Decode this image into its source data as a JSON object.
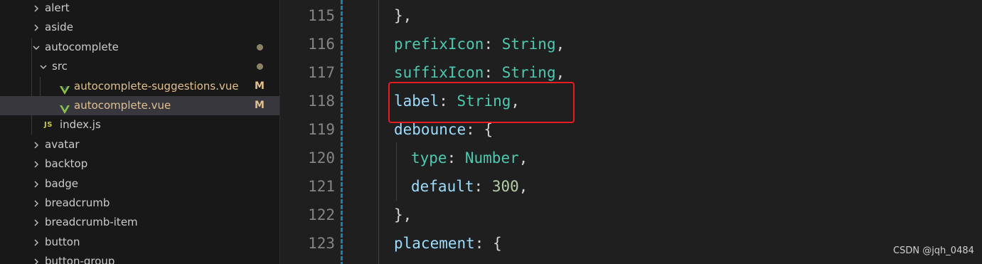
{
  "sidebar": {
    "items": [
      {
        "label": "alert",
        "kind": "folder",
        "expanded": false
      },
      {
        "label": "aside",
        "kind": "folder",
        "expanded": false
      },
      {
        "label": "autocomplete",
        "kind": "folder",
        "expanded": true,
        "modified_dot": true
      },
      {
        "label": "src",
        "kind": "folder",
        "expanded": true,
        "modified_dot": true
      },
      {
        "label": "autocomplete-suggestions.vue",
        "kind": "vue",
        "status": "M"
      },
      {
        "label": "autocomplete.vue",
        "kind": "vue",
        "status": "M",
        "selected": true
      },
      {
        "label": "index.js",
        "kind": "js",
        "icon_text": "JS"
      },
      {
        "label": "avatar",
        "kind": "folder",
        "expanded": false
      },
      {
        "label": "backtop",
        "kind": "folder",
        "expanded": false
      },
      {
        "label": "badge",
        "kind": "folder",
        "expanded": false
      },
      {
        "label": "breadcrumb",
        "kind": "folder",
        "expanded": false
      },
      {
        "label": "breadcrumb-item",
        "kind": "folder",
        "expanded": false
      },
      {
        "label": "button",
        "kind": "folder",
        "expanded": false
      },
      {
        "label": "button-group",
        "kind": "folder",
        "expanded": false
      }
    ]
  },
  "editor": {
    "lines": [
      {
        "num": "115",
        "tokens": [
          {
            "t": "},",
            "c": "punc"
          }
        ]
      },
      {
        "num": "116",
        "tokens": [
          {
            "t": "prefixIcon",
            "c": "key"
          },
          {
            "t": ": ",
            "c": "punc"
          },
          {
            "t": "String",
            "c": "type"
          },
          {
            "t": ",",
            "c": "punc"
          }
        ]
      },
      {
        "num": "117",
        "tokens": [
          {
            "t": "suffixIcon",
            "c": "key"
          },
          {
            "t": ": ",
            "c": "punc"
          },
          {
            "t": "String",
            "c": "type"
          },
          {
            "t": ",",
            "c": "punc"
          }
        ]
      },
      {
        "num": "118",
        "tokens": [
          {
            "t": "label",
            "c": "prop"
          },
          {
            "t": ": ",
            "c": "punc"
          },
          {
            "t": "String",
            "c": "type"
          },
          {
            "t": ",",
            "c": "punc"
          }
        ]
      },
      {
        "num": "119",
        "tokens": [
          {
            "t": "debounce",
            "c": "prop"
          },
          {
            "t": ": {",
            "c": "punc"
          }
        ]
      },
      {
        "num": "120",
        "indent": 1,
        "tokens": [
          {
            "t": "type",
            "c": "key"
          },
          {
            "t": ": ",
            "c": "punc"
          },
          {
            "t": "Number",
            "c": "type"
          },
          {
            "t": ",",
            "c": "punc"
          }
        ]
      },
      {
        "num": "121",
        "indent": 1,
        "tokens": [
          {
            "t": "default",
            "c": "prop"
          },
          {
            "t": ": ",
            "c": "punc"
          },
          {
            "t": "300",
            "c": "num"
          },
          {
            "t": ",",
            "c": "punc"
          }
        ]
      },
      {
        "num": "122",
        "tokens": [
          {
            "t": "},",
            "c": "punc"
          }
        ]
      },
      {
        "num": "123",
        "tokens": [
          {
            "t": "placement",
            "c": "prop"
          },
          {
            "t": ": {",
            "c": "punc"
          }
        ]
      }
    ]
  },
  "watermark": "CSDN @jqh_0484",
  "colors": {
    "highlight_box": "#e51c23",
    "vue_green": "#8dc149",
    "modified_label": "#e2c08d",
    "js_yellow": "#cbcb41"
  }
}
